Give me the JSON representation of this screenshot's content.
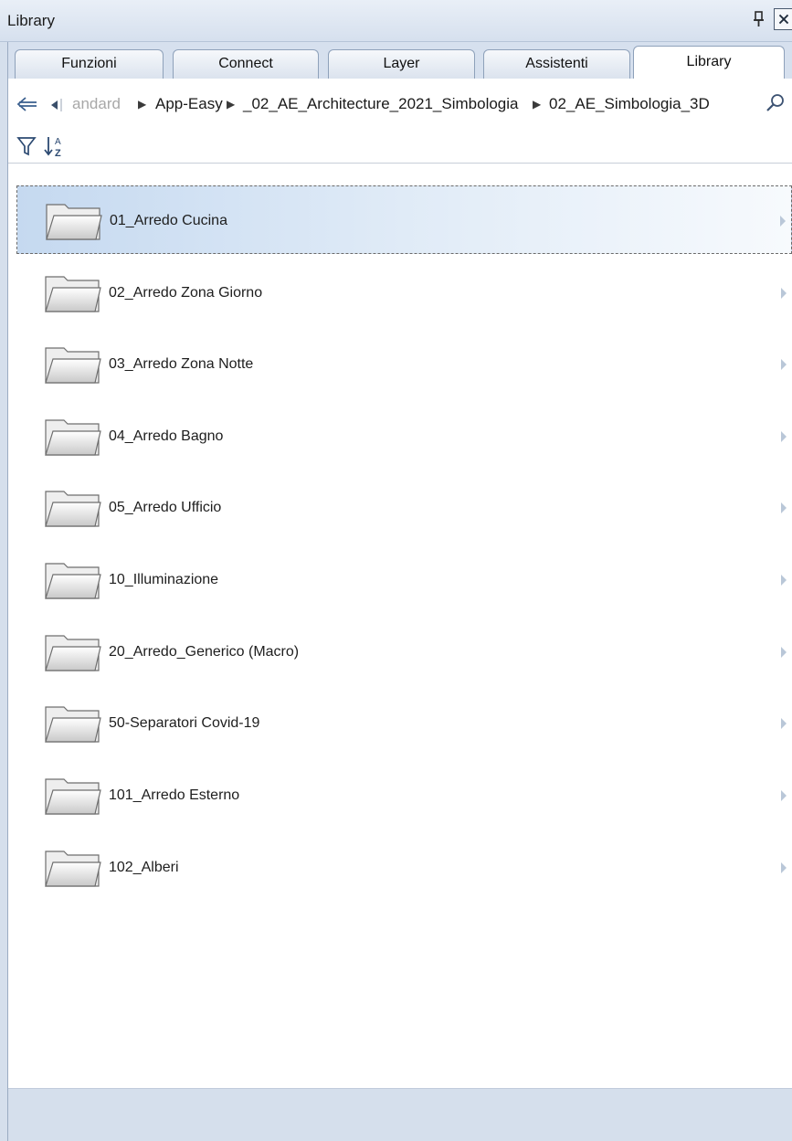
{
  "window": {
    "title": "Library"
  },
  "tabs": [
    {
      "label": "Funzioni"
    },
    {
      "label": "Connect"
    },
    {
      "label": "Layer"
    },
    {
      "label": "Assistenti"
    },
    {
      "label": "Library",
      "active": true
    }
  ],
  "breadcrumb": {
    "items": [
      "andard",
      "App-Easy",
      "_02_AE_Architecture_2021_Simbologia",
      "02_AE_Simbologia_3D"
    ]
  },
  "icons": {
    "back": "back-arrow-icon",
    "history": "history-dropdown-icon",
    "search": "search-icon",
    "filter": "filter-icon",
    "sort": "sort-az-icon",
    "pin": "pin-icon",
    "close": "close-icon",
    "folder": "folder-icon",
    "expand": "chevron-right-icon"
  },
  "folders": [
    {
      "name": "01_Arredo Cucina",
      "selected": true
    },
    {
      "name": "02_Arredo Zona Giorno"
    },
    {
      "name": "03_Arredo Zona Notte"
    },
    {
      "name": "04_Arredo Bagno"
    },
    {
      "name": "05_Arredo Ufficio"
    },
    {
      "name": "10_Illuminazione"
    },
    {
      "name": "20_Arredo_Generico (Macro)"
    },
    {
      "name": "50-Separatori Covid-19"
    },
    {
      "name": "101_Arredo Esterno"
    },
    {
      "name": "102_Alberi"
    }
  ],
  "colors": {
    "chrome": "#d6e0ee",
    "selection": "#c5d9f0",
    "border": "#8ea1ba"
  }
}
